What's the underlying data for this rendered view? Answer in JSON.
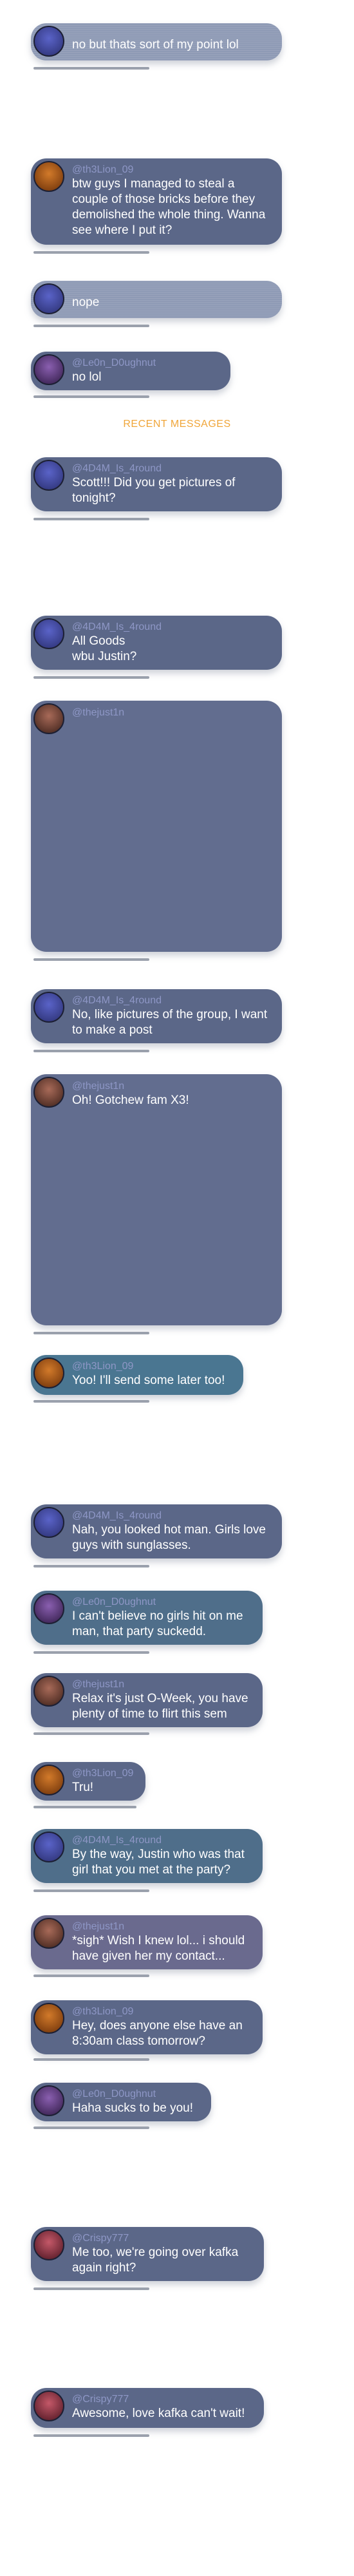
{
  "divider_label": "RECENT MESSAGES",
  "messages": [
    {
      "name": "",
      "text": "no but thats sort of my point lol"
    },
    {
      "name": "@th3Lion_09",
      "text": "btw guys I managed to steal a couple of those bricks before they demolished the whole thing. Wanna see where I put it?"
    },
    {
      "name": "",
      "text": "nope"
    },
    {
      "name": "@Le0n_D0ughnut",
      "text": "no lol"
    },
    {
      "name": "@4D4M_Is_4round",
      "text": "Scott!!! Did you get pictures of tonight?"
    },
    {
      "name": "@4D4M_Is_4round",
      "text": "All Goods\nwbu Justin?"
    },
    {
      "name": "@thejust1n",
      "text": ""
    },
    {
      "name": "@4D4M_Is_4round",
      "text": "No, like pictures of the group, I want to make a post"
    },
    {
      "name": "@thejust1n",
      "text": "Oh! Gotchew fam X3!"
    },
    {
      "name": "@th3Lion_09",
      "text": "Yoo! I'll send some later too!"
    },
    {
      "name": "@4D4M_Is_4round",
      "text": "Nah, you looked hot man. Girls love guys with sunglasses."
    },
    {
      "name": "@Le0n_D0ughnut",
      "text": "I can't believe no girls hit on me man, that party suckedd."
    },
    {
      "name": "@thejust1n",
      "text": "Relax it's just O-Week, you have plenty of time to flirt this sem"
    },
    {
      "name": "@th3Lion_09",
      "text": "Tru!"
    },
    {
      "name": "@4D4M_Is_4round",
      "text": "By the way, Justin who was that girl that you met at the party?"
    },
    {
      "name": "@thejust1n",
      "text": "*sigh* Wish I knew lol... i should have given her my contact..."
    },
    {
      "name": "@th3Lion_09",
      "text": "Hey, does anyone else have an 8:30am class tomorrow?"
    },
    {
      "name": "@Le0n_D0ughnut",
      "text": "Haha sucks to be you!"
    },
    {
      "name": "@Crispy777",
      "text": "Me too, we're going over kafka again right?"
    },
    {
      "name": "@Crispy777",
      "text": "Awesome, love kafka can't wait!"
    }
  ],
  "colors": {
    "bubble_slate": "#5b6788",
    "bubble_blue": "#4f6e8a",
    "bubble_teal": "#4a7691",
    "bubble_purple": "#6a6a8e",
    "bubble_faded": "#8e9ab5",
    "name_text": "#8e97c6",
    "divider": "#f0a63a",
    "avatar_adam": "#3a3f8f",
    "avatar_justin": "#6b4036",
    "avatar_lion": "#a8520f",
    "avatar_leon": "#5a3a7a",
    "avatar_crispy": "#8a2f3e"
  },
  "avatars": [
    "adam-avatar-icon",
    "justin-avatar-icon",
    "lion-avatar-icon",
    "leon-avatar-icon",
    "crispy-avatar-icon"
  ]
}
